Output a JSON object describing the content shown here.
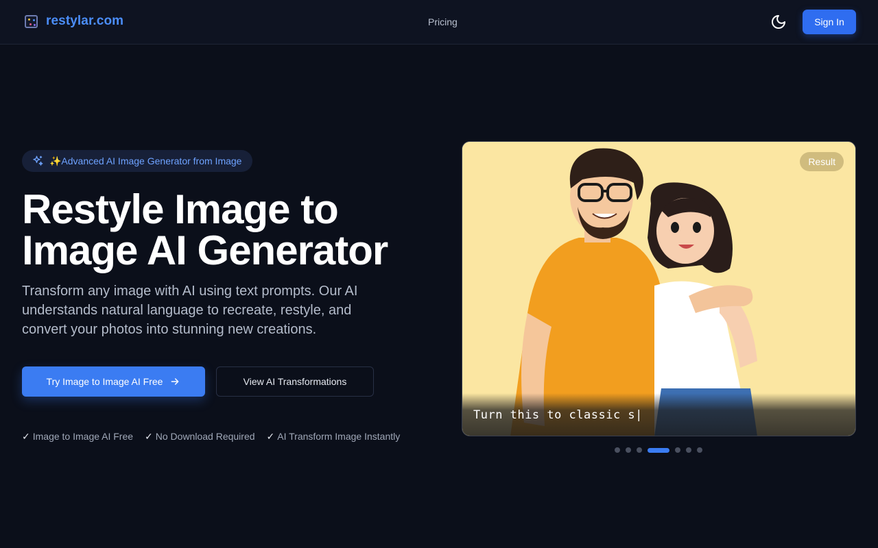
{
  "header": {
    "brand": "restylar.com",
    "nav": {
      "pricing": "Pricing"
    },
    "signin_label": "Sign In"
  },
  "hero": {
    "badge": "✨Advanced AI Image Generator from Image",
    "title_line1": "Restyle Image to",
    "title_line2": "Image AI Generator",
    "description": "Transform any image with AI using text prompts. Our AI understands natural language to recreate, restyle, and convert your photos into stunning new creations.",
    "cta_primary": "Try Image to Image AI Free",
    "cta_secondary": "View AI Transformations",
    "features": [
      "Image to Image AI Free",
      "No Download Required",
      "AI Transform Image Instantly"
    ]
  },
  "showcase": {
    "result_label": "Result",
    "prompt_text": "Turn this to classic s|",
    "carousel": {
      "count": 7,
      "active_index": 3
    }
  },
  "colors": {
    "background": "#0b0f1a",
    "accent": "#3b7cf2",
    "brand": "#4b8df8"
  }
}
